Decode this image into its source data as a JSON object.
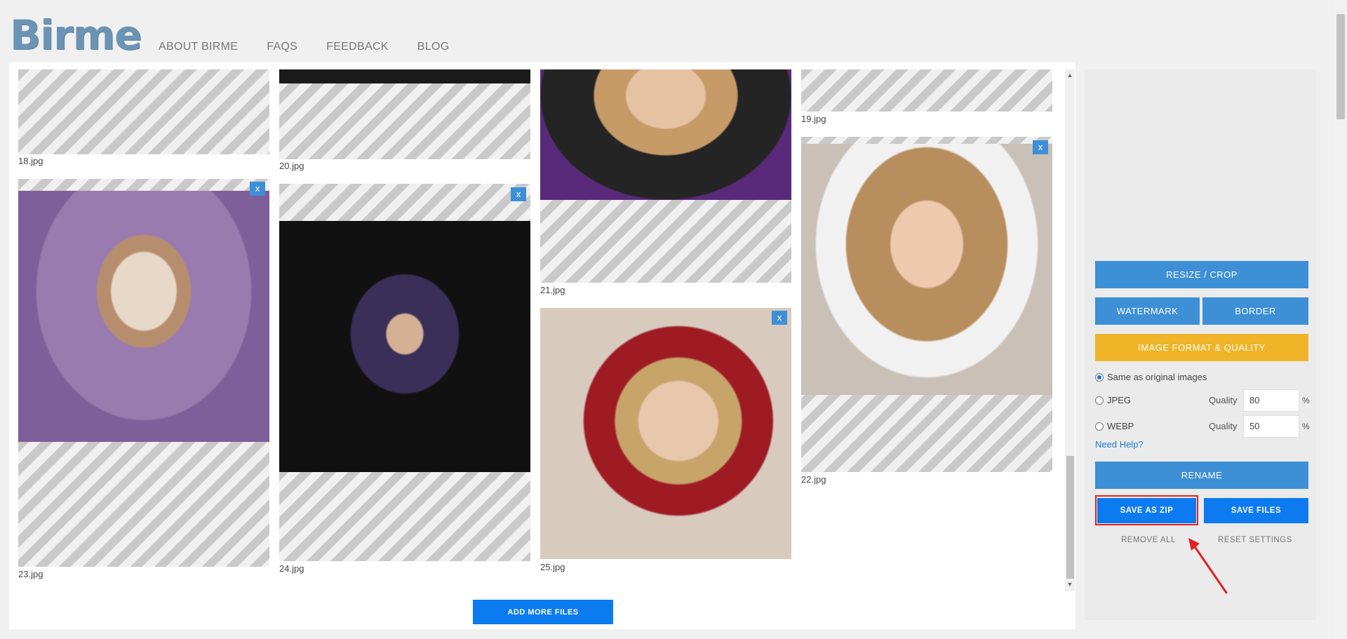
{
  "header": {
    "logo": "Birme",
    "nav": [
      "ABOUT BIRME",
      "FAQS",
      "FEEDBACK",
      "BLOG"
    ]
  },
  "gallery": {
    "files": [
      "18.jpg",
      "20.jpg",
      "21.jpg",
      "19.jpg",
      "23.jpg",
      "24.jpg",
      "25.jpg",
      "22.jpg"
    ],
    "remove_label": "x",
    "add_more": "ADD MORE FILES"
  },
  "panel": {
    "resize": "RESIZE / CROP",
    "watermark": "WATERMARK",
    "border": "BORDER",
    "format": "IMAGE FORMAT & QUALITY",
    "options": {
      "same": "Same as original images",
      "jpeg": "JPEG",
      "webp": "WEBP",
      "selected": "same"
    },
    "quality_label": "Quality",
    "jpeg_quality": "80",
    "webp_quality": "50",
    "pct": "%",
    "help": "Need Help?",
    "rename": "RENAME",
    "save_zip": "SAVE AS ZIP",
    "save_files": "SAVE FILES",
    "remove_all": "REMOVE ALL",
    "reset": "RESET SETTINGS"
  },
  "colors": {
    "primary_blue": "#3d8fd6",
    "save_blue": "#0d7bf0",
    "format_yellow": "#f0b429",
    "highlight_red": "#e02020"
  }
}
